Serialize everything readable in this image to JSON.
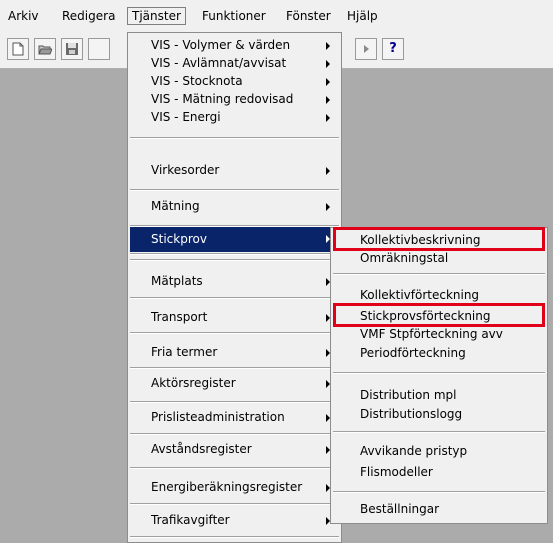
{
  "menubar": {
    "items": [
      "Arkiv",
      "Redigera",
      "Tjänster",
      "Funktioner",
      "Fönster",
      "Hjälp"
    ]
  },
  "toolbar": {
    "help_label": "?"
  },
  "menu_tjanster": {
    "items": [
      "VIS - Volymer & värden",
      "VIS - Avlämnat/avvisat",
      "VIS - Stocknota",
      "VIS - Mätning redovisad",
      "VIS - Energi",
      "Virkesorder",
      "Mätning",
      "Stickprov",
      "Mätplats",
      "Transport",
      "Fria termer",
      "Aktörsregister",
      "Prislisteadministration",
      "Avståndsregister",
      "Energiberäkningsregister",
      "Trafikavgifter"
    ]
  },
  "menu_stickprov": {
    "items": [
      "Kollektivbeskrivning",
      "Omräkningstal",
      "Kollektivförteckning",
      "Stickprovsförteckning",
      "VMF Stpförteckning avv",
      "Periodförteckning",
      "Distribution mpl",
      "Distributionslogg",
      "Avvikande pristyp",
      "Flismodeller",
      "Beställningar"
    ]
  },
  "colors": {
    "highlight": "#0a246a",
    "annotation_red": "#e0001a",
    "workspace": "#ababab"
  }
}
